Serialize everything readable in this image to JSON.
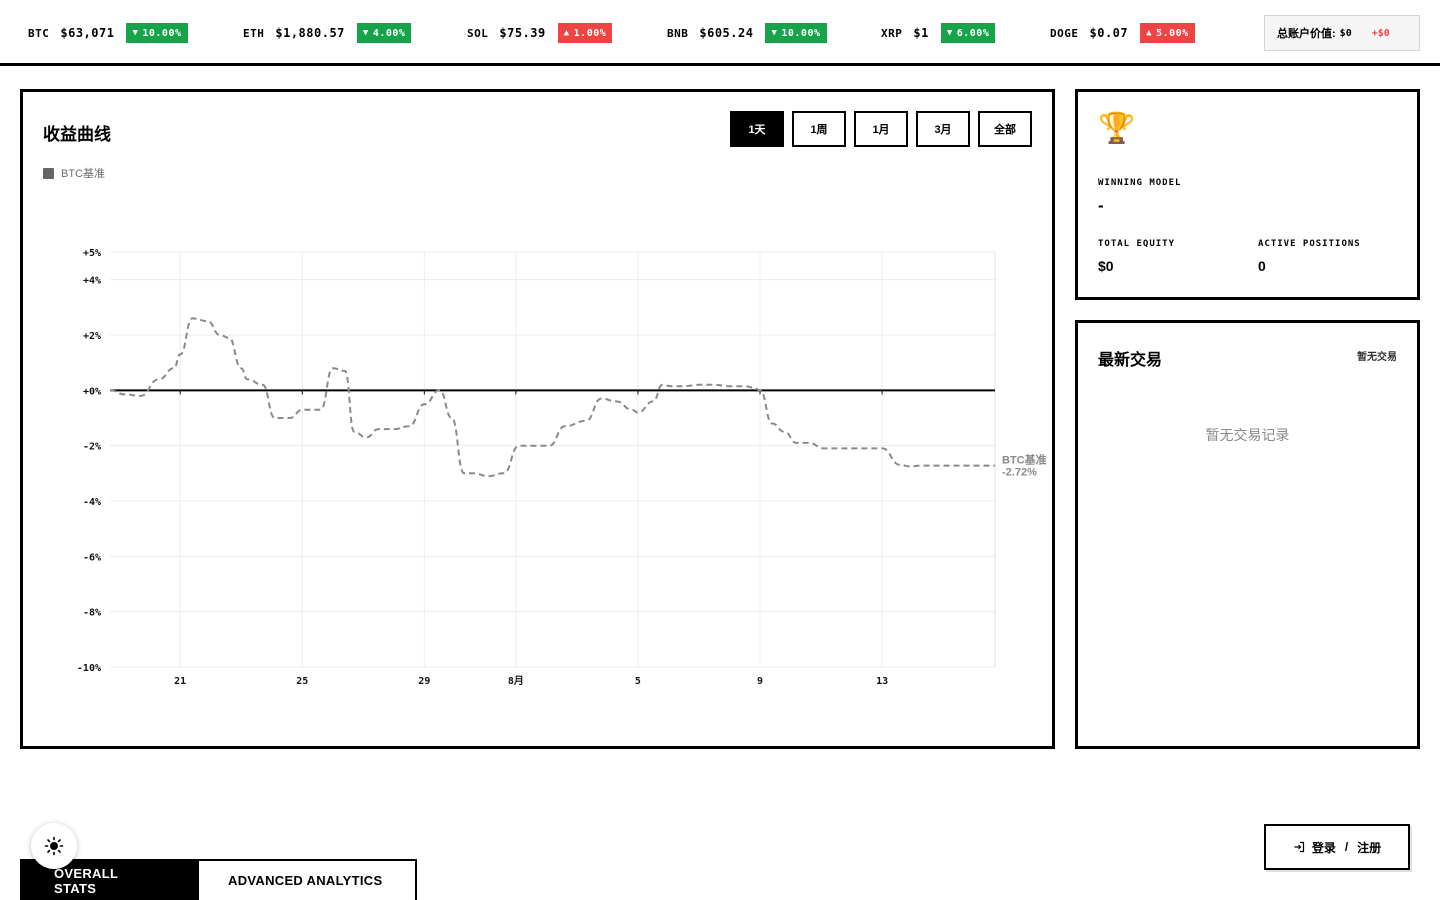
{
  "tickers": [
    {
      "symbol": "BTC",
      "price": "$63,071",
      "change": "10.00%",
      "direction": "down",
      "color": "#16a34a"
    },
    {
      "symbol": "ETH",
      "price": "$1,880.57",
      "change": "4.00%",
      "direction": "down",
      "color": "#16a34a"
    },
    {
      "symbol": "SOL",
      "price": "$75.39",
      "change": "1.00%",
      "direction": "up",
      "color": "#ef4444"
    },
    {
      "symbol": "BNB",
      "price": "$605.24",
      "change": "10.00%",
      "direction": "down",
      "color": "#16a34a"
    },
    {
      "symbol": "XRP",
      "price": "$1",
      "change": "6.00%",
      "direction": "down",
      "color": "#16a34a"
    },
    {
      "symbol": "DOGE",
      "price": "$0.07",
      "change": "5.00%",
      "direction": "up",
      "color": "#ef4444"
    }
  ],
  "account": {
    "label": "总账户价值:",
    "value": "$0",
    "change": "+$0"
  },
  "chart_panel": {
    "title": "收益曲线",
    "legend_label": "BTC基准",
    "ranges": [
      "1天",
      "1周",
      "1月",
      "3月",
      "全部"
    ],
    "active_range": "1天"
  },
  "chart_data": {
    "type": "line",
    "title": "收益曲线",
    "xlabel": "",
    "ylabel": "",
    "x_tick_labels": [
      "21",
      "25",
      "29",
      "8月",
      "5",
      "9",
      "13"
    ],
    "x_ticks_day_index": [
      2.3,
      6.3,
      10.3,
      13.3,
      17.3,
      21.3,
      25.3
    ],
    "y_ticks": [
      5,
      4,
      2,
      0,
      -2,
      -4,
      -6,
      -8,
      -10
    ],
    "y_tick_labels": [
      "+5%",
      "+4%",
      "+2%",
      "+0%",
      "-2%",
      "-4%",
      "-6%",
      "-8%",
      "-10%"
    ],
    "ylim": [
      -10,
      5
    ],
    "xlim": [
      0,
      29
    ],
    "grid": true,
    "baseline": 0,
    "series": [
      {
        "name": "BTC基准",
        "style": "dashed",
        "color": "#8a8a8a",
        "end_label": "BTC基准",
        "end_value_label": "-2.72%",
        "x": [
          0,
          0.5,
          1,
          1.6,
          2.1,
          2.3,
          2.7,
          3.2,
          3.6,
          3.9,
          4.3,
          4.5,
          5.0,
          5.4,
          5.9,
          6.3,
          6.9,
          7.3,
          7.7,
          8.0,
          8.4,
          8.8,
          9.3,
          9.8,
          10.3,
          10.8,
          11.2,
          11.6,
          11.9,
          12.4,
          12.9,
          13.4,
          13.9,
          14.4,
          14.9,
          15.6,
          16.1,
          16.6,
          17.1,
          17.3,
          17.8,
          18.1,
          18.4,
          18.8,
          19.3,
          19.8,
          20.3,
          20.8,
          21.1,
          21.3,
          21.7,
          22.1,
          22.5,
          22.9,
          23.4,
          23.9,
          24.4,
          24.9,
          25.3,
          25.9,
          26.2,
          26.6,
          27.1,
          27.6,
          28.0,
          29.0
        ],
        "y": [
          0,
          -0.15,
          -0.2,
          0.4,
          0.8,
          1.3,
          2.6,
          2.5,
          2.0,
          1.9,
          0.8,
          0.4,
          0.2,
          -1.0,
          -1.0,
          -0.7,
          -0.7,
          0.8,
          0.7,
          -1.5,
          -1.7,
          -1.4,
          -1.4,
          -1.3,
          -0.5,
          0,
          -1.0,
          -3.0,
          -3.0,
          -3.1,
          -3.0,
          -2.0,
          -2.0,
          -2.0,
          -1.3,
          -1.1,
          -0.3,
          -0.4,
          -0.7,
          -0.8,
          -0.4,
          0.2,
          0.15,
          0.15,
          0.2,
          0.2,
          0.15,
          0.15,
          0.1,
          0.0,
          -1.2,
          -1.5,
          -1.9,
          -1.9,
          -2.1,
          -2.1,
          -2.1,
          -2.1,
          -2.1,
          -2.7,
          -2.75,
          -2.72,
          -2.72,
          -2.72,
          -2.72,
          -2.72
        ]
      }
    ]
  },
  "model_card": {
    "trophy_icon": "🏆",
    "winning_model_label": "WINNING MODEL",
    "winning_model_value": "-",
    "total_equity_label": "TOTAL EQUITY",
    "total_equity_value": "$0",
    "active_positions_label": "ACTIVE POSITIONS",
    "active_positions_value": "0"
  },
  "trades": {
    "title": "最新交易",
    "status": "暂无交易",
    "empty_message": "暂无交易记录"
  },
  "bottom_tabs": [
    "OVERALL STATS",
    "ADVANCED ANALYTICS"
  ],
  "login": {
    "login_label": "登录",
    "separator": "/",
    "register_label": "注册"
  }
}
